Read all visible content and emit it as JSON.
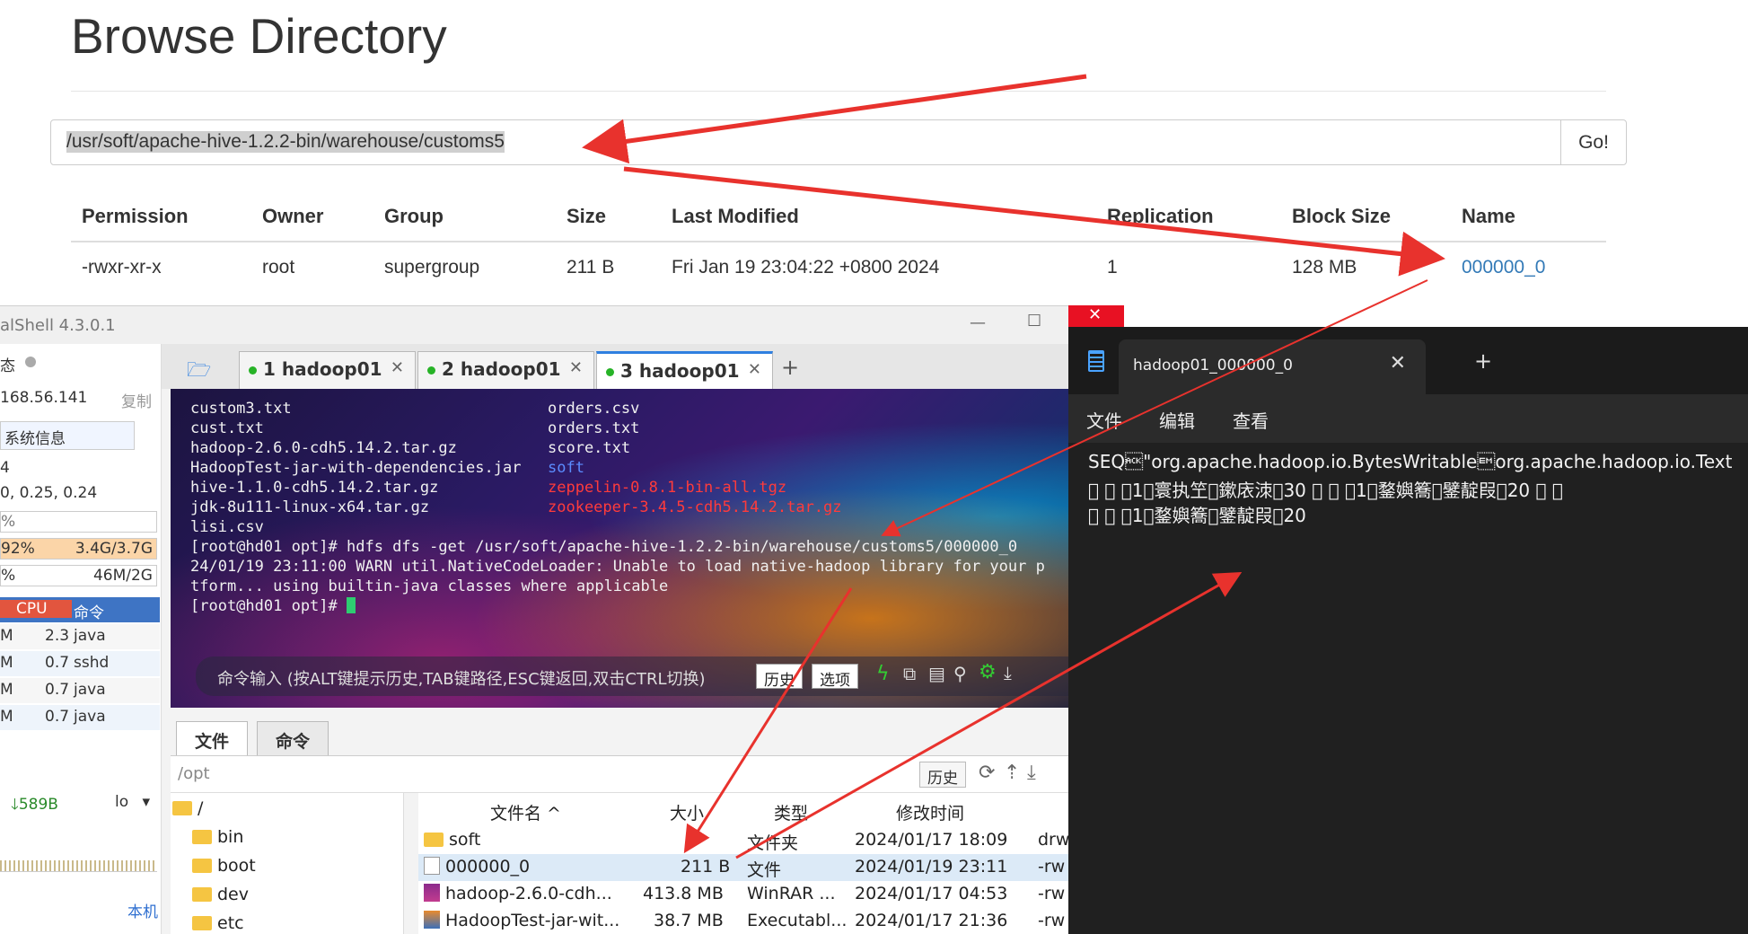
{
  "browse": {
    "title": "Browse Directory",
    "path": "/usr/soft/apache-hive-1.2.2-bin/warehouse/customs5",
    "go_label": "Go!",
    "columns": [
      "Permission",
      "Owner",
      "Group",
      "Size",
      "Last Modified",
      "Replication",
      "Block Size",
      "Name"
    ],
    "row": {
      "permission": "-rwxr-xr-x",
      "owner": "root",
      "group": "supergroup",
      "size": "211 B",
      "modified": "Fri Jan 19 23:04:22 +0800 2024",
      "replication": "1",
      "block_size": "128 MB",
      "name": "000000_0"
    }
  },
  "xshell": {
    "title": "alShell 4.3.0.1",
    "side": {
      "status": "态",
      "ip": "168.56.141",
      "copy": "复制",
      "sysinfo": "系统信息",
      "cores": "4",
      "load": "0, 0.25, 0.24",
      "cpu_pct": "%",
      "mem_pct": "92%",
      "mem": "3.4G/3.7G",
      "swap_pct": "%",
      "swap": "46M/2G",
      "col_cpu": "CPU",
      "col_cmd": "命令",
      "procs": [
        {
          "m": "M",
          "cpu": "2.3",
          "cmd": "java"
        },
        {
          "m": "M",
          "cpu": "0.7",
          "cmd": "sshd"
        },
        {
          "m": "M",
          "cpu": "0.7",
          "cmd": "java"
        },
        {
          "m": "M",
          "cpu": "0.7",
          "cmd": "java"
        }
      ],
      "net_down": "589B",
      "net_iface": "lo",
      "local": "本机"
    },
    "tabs": [
      "1 hadoop01",
      "2 hadoop01",
      "3 hadoop01"
    ],
    "terminal": {
      "left": [
        "custom3.txt",
        "cust.txt",
        "hadoop-2.6.0-cdh5.14.2.tar.gz",
        "HadoopTest-jar-with-dependencies.jar",
        "hive-1.1.0-cdh5.14.2.tar.gz",
        "jdk-8u111-linux-x64.tar.gz",
        "lisi.csv"
      ],
      "right": [
        "orders.csv",
        "orders.txt",
        "score.txt",
        "soft",
        "zeppelin-0.8.1-bin-all.tgz",
        "zookeeper-3.4.5-cdh5.14.2.tar.gz"
      ],
      "line_cmd": "[root@hd01 opt]# hdfs dfs -get /usr/soft/apache-hive-1.2.2-bin/warehouse/customs5/000000_0",
      "line_warn": "24/01/19 23:11:00 WARN util.NativeCodeLoader: Unable to load native-hadoop library for your p",
      "line_warn2": "tform... using builtin-java classes where applicable",
      "line_prompt": "[root@hd01 opt]# "
    },
    "cmd_placeholder": "命令输入 (按ALT键提示历史,TAB键路径,ESC键返回,双击CTRL切换)",
    "cmd_history": "历史",
    "cmd_options": "选项",
    "file_tabs": [
      "文件",
      "命令"
    ],
    "cur_path": "/opt",
    "history_btn": "历史",
    "tree": [
      "/",
      "bin",
      "boot",
      "dev",
      "etc"
    ],
    "file_cols": [
      "文件名 ^",
      "大小",
      "类型",
      "修改时间"
    ],
    "files": [
      {
        "name": "soft",
        "size": "",
        "type": "文件夹",
        "time": "2024/01/17 18:09",
        "perm": "drw"
      },
      {
        "name": "000000_0",
        "size": "211 B",
        "type": "文件",
        "time": "2024/01/19 23:11",
        "perm": "-rw"
      },
      {
        "name": "hadoop-2.6.0-cdh...",
        "size": "413.8 MB",
        "type": "WinRAR ...",
        "time": "2024/01/17 04:53",
        "perm": "-rw"
      },
      {
        "name": "HadoopTest-jar-wit...",
        "size": "38.7 MB",
        "type": "Executabl...",
        "time": "2024/01/17 21:36",
        "perm": "-rw"
      }
    ]
  },
  "notepad": {
    "tab_title": "hadoop01_000000_0",
    "menu": [
      "文件",
      "编辑",
      "查看"
    ],
    "lines": [
      "SEQ\u0006\"org.apache.hadoop.io.BytesWritable\u0019org.apache.hadoop.io.Text",
      "\u0000  \u0000   \u00001\u0000寰执笁\u0000鏉庡洓\u000030   \u0000  \u0000   \u00001\u0000鍪嬩簥\u0000鐾靛叚\u000020   \u0000  \u0000",
      "\u0000  \u0000   \u00001\u0000鍪嬩簥\u0000鐾靛叚\u000020"
    ]
  },
  "colors": {
    "link": "#337ab7",
    "arrow": "#e8322d",
    "terminal_red": "#ff3b3b",
    "terminal_blue": "#5b8cff"
  }
}
